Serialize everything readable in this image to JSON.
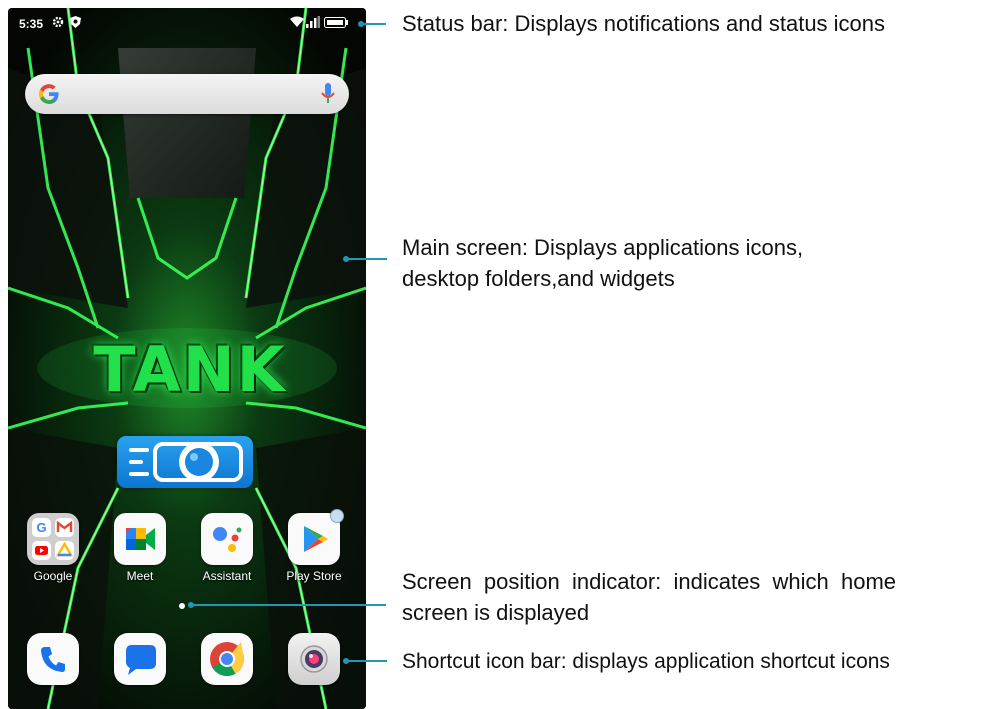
{
  "status_bar": {
    "time": "5:35"
  },
  "wallpaper": {
    "logo_text": "TANK"
  },
  "apps": [
    {
      "label": "Google"
    },
    {
      "label": "Meet"
    },
    {
      "label": "Assistant"
    },
    {
      "label": "Play Store"
    }
  ],
  "annotations": {
    "status_bar": "Status bar:  Displays notifications and status icons",
    "main_screen_line1": "Main screen: Displays applications icons,",
    "main_screen_line2": "desktop folders,and widgets",
    "indicator_line1": "Screen  position  indicator:  indicates  which  home",
    "indicator_line2": "screen is displayed",
    "shortcut_bar": "Shortcut icon bar: displays application shortcut icons"
  },
  "colors": {
    "accent_green": "#22e04a",
    "leader_line": "#1f97b8"
  }
}
